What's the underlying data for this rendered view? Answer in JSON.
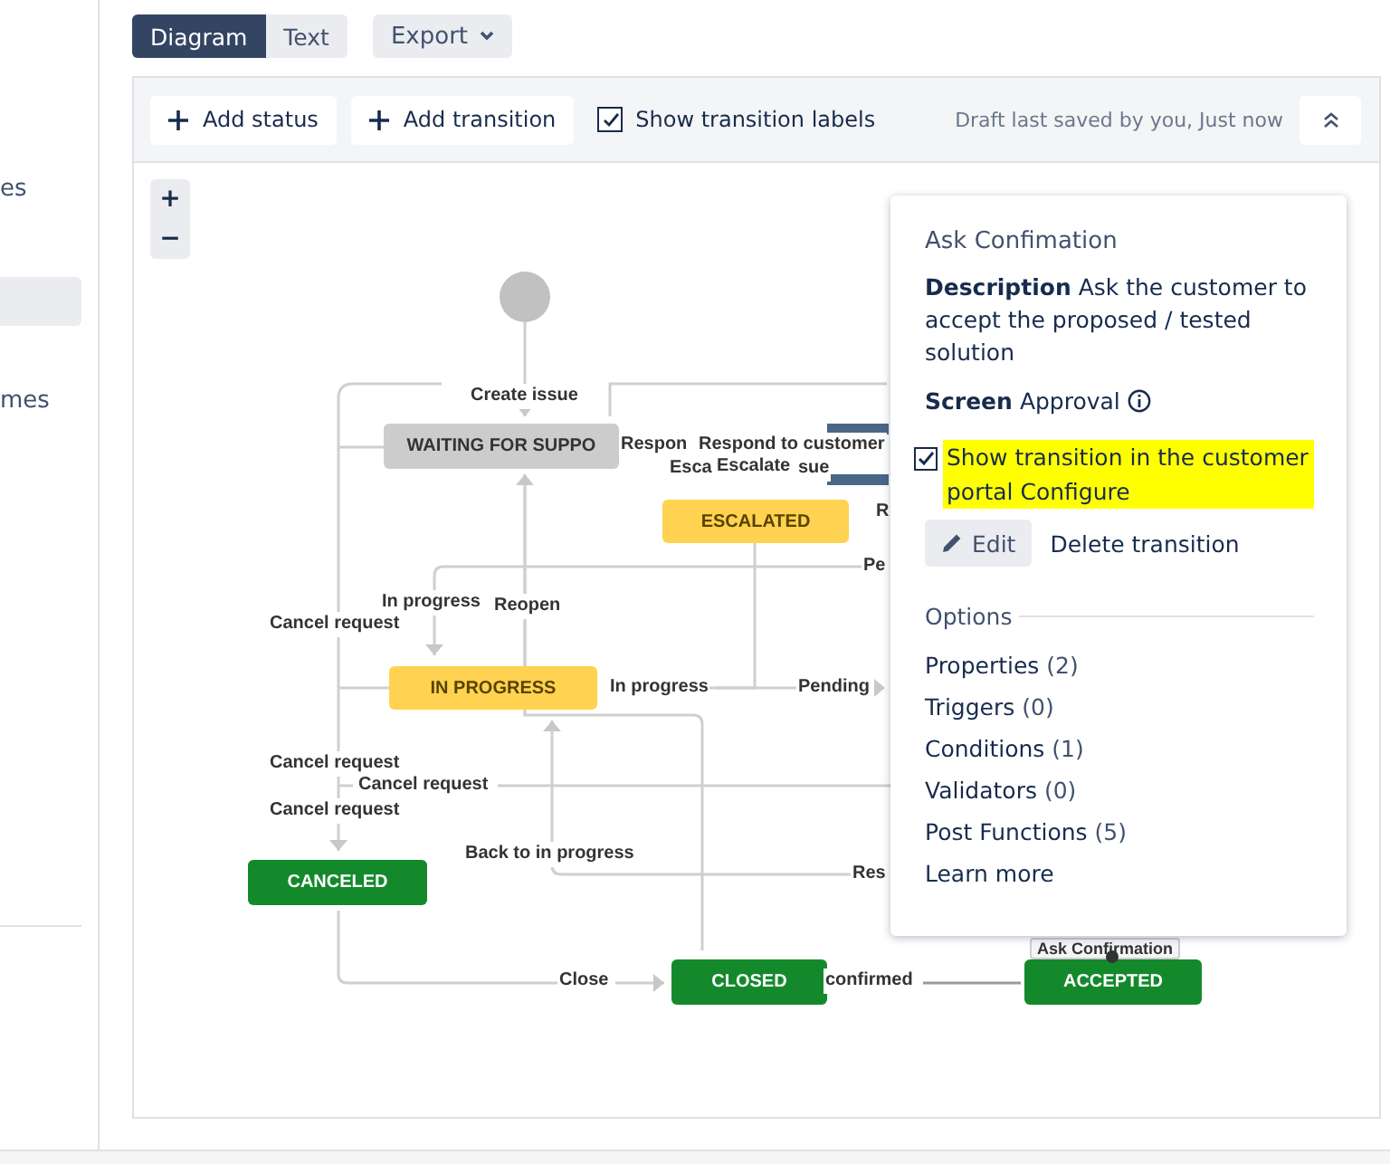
{
  "sidebar": {
    "items": [
      {
        "label": "es",
        "selected": false
      },
      {
        "selected": true
      },
      {
        "label": "mes",
        "selected": false
      }
    ]
  },
  "view_tabs": [
    {
      "label": "Diagram",
      "selected": true
    },
    {
      "label": "Text",
      "selected": false
    }
  ],
  "export_button": {
    "label": "Export"
  },
  "toolbar": {
    "add_status": "Add status",
    "add_transition": "Add transition",
    "show_labels": {
      "label": "Show transition labels",
      "checked": true
    },
    "draft_status": "Draft last saved by you, Just now"
  },
  "zoom": {
    "plus": "+",
    "minus": "−"
  },
  "diagram": {
    "statuses": [
      {
        "label": "WAITING FOR SUPPO",
        "kind": "todo"
      },
      {
        "label": "ESCALATED",
        "kind": "progress"
      },
      {
        "label": "IN PROGRESS",
        "kind": "progress"
      },
      {
        "label": "CANCELED",
        "kind": "done"
      },
      {
        "label": "CLOSED",
        "kind": "done"
      },
      {
        "label": "ACCEPTED",
        "kind": "done"
      }
    ],
    "labels": [
      {
        "text": "Create issue"
      },
      {
        "text": "Respon"
      },
      {
        "text": "Respond to customer"
      },
      {
        "text": "Esca"
      },
      {
        "text": "Escalate"
      },
      {
        "text": "sue"
      },
      {
        "text": "R"
      },
      {
        "text": "Pe"
      },
      {
        "text": "In progress"
      },
      {
        "text": "Reopen"
      },
      {
        "text": "Cancel request"
      },
      {
        "text": "In progress"
      },
      {
        "text": "Pending"
      },
      {
        "text": "Cancel request"
      },
      {
        "text": "Cancel request"
      },
      {
        "text": "Cancel request"
      },
      {
        "text": "Back to in progress"
      },
      {
        "text": "Res"
      },
      {
        "text": "Close"
      },
      {
        "text": "confirmed"
      },
      {
        "text": "Ask Confirmation"
      }
    ]
  },
  "transition_panel": {
    "title": "Ask Confimation",
    "description": "**Description** Ask the customer to accept the proposed / tested solution",
    "screen_label": "Screen",
    "screen_value": "Approval",
    "portal_option": {
      "label": "Show transition in the customer portal",
      "checked": true,
      "link": "Configure"
    },
    "edit_button": "Edit",
    "delete_link": "Delete transition",
    "options_heading": "Options",
    "options": [
      {
        "label": "Properties",
        "count": "(2)"
      },
      {
        "label": "Triggers",
        "count": "(0)"
      },
      {
        "label": "Conditions",
        "count": "(1)"
      },
      {
        "label": "Validators",
        "count": "(0)"
      },
      {
        "label": "Post Functions",
        "count": "(5)"
      }
    ],
    "learn_more": "Learn more"
  }
}
